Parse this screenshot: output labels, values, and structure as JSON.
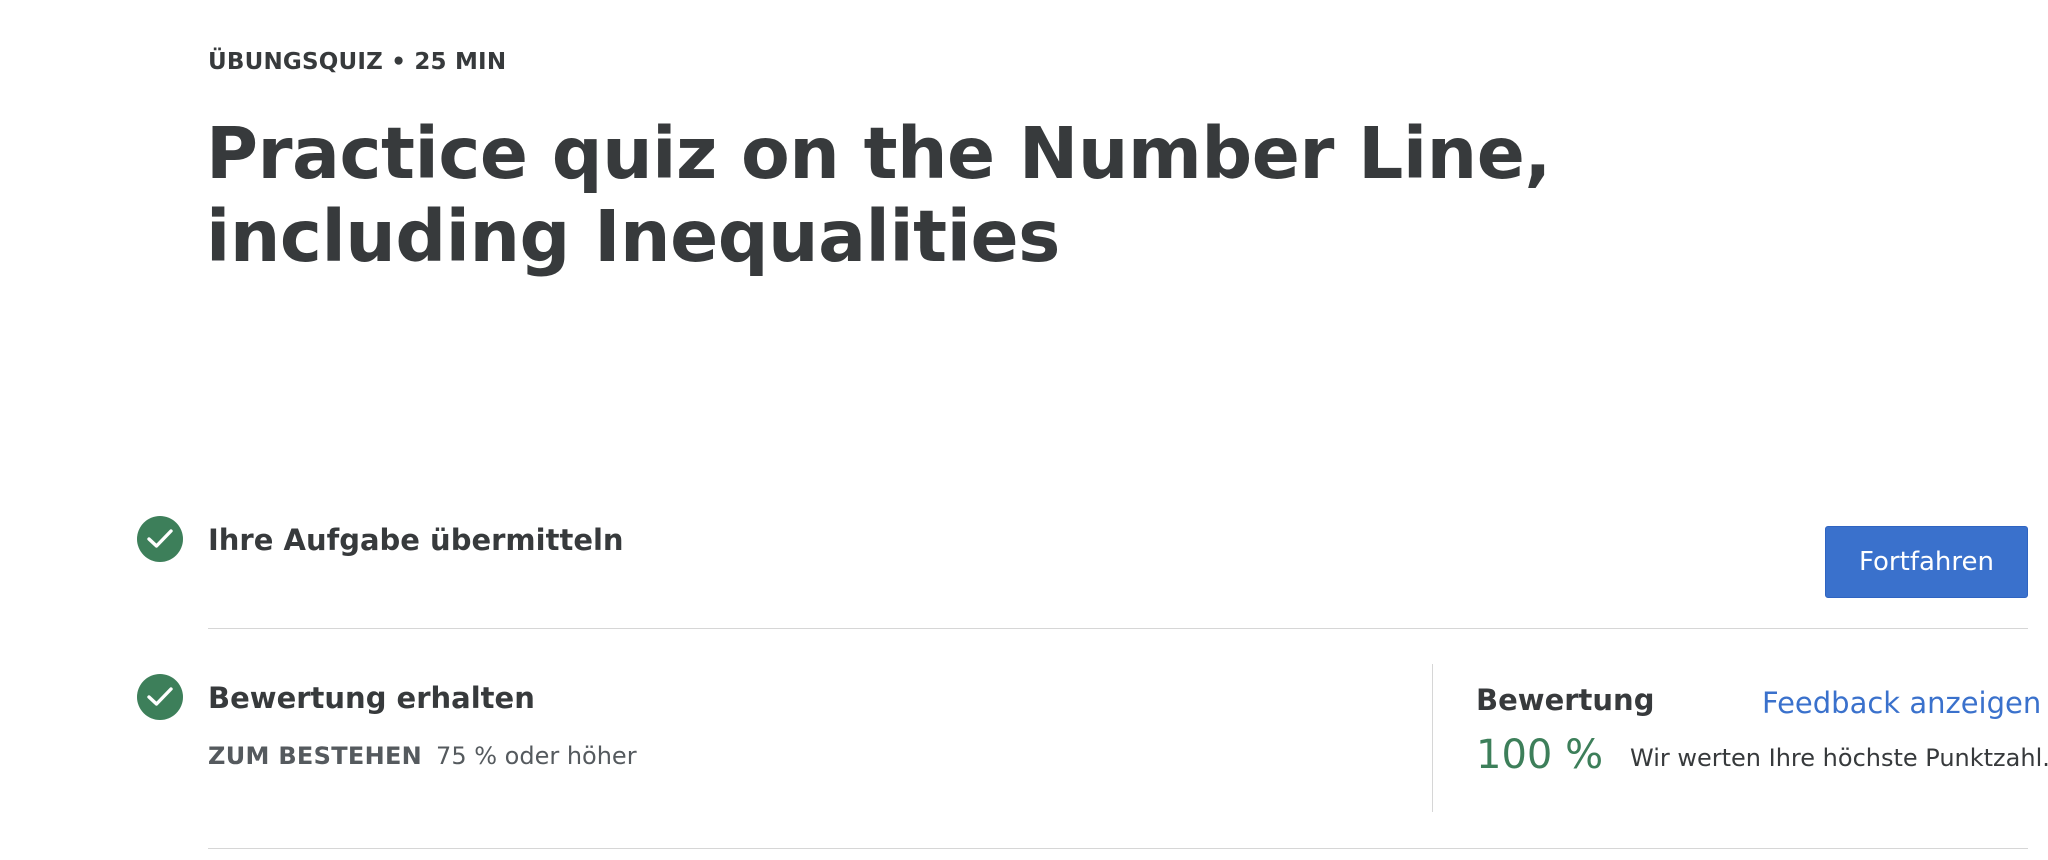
{
  "header": {
    "meta": "ÜBUNGSQUIZ • 25 MIN",
    "title": "Practice quiz on the Number Line, including Inequalities"
  },
  "submit_step": {
    "icon": "check-icon",
    "title": "Ihre Aufgabe übermitteln",
    "button_label": "Fortfahren"
  },
  "grade_step": {
    "icon": "check-icon",
    "title": "Bewertung erhalten",
    "pass_label": "ZUM BESTEHEN",
    "pass_value": "75 % oder höher",
    "grade_label": "Bewertung",
    "feedback_link": "Feedback anzeigen",
    "grade_value": "100 %",
    "grade_note": "Wir werten Ihre höchste Punktzahl."
  },
  "colors": {
    "success": "#3d7f5a",
    "accent": "#3a71cc",
    "text": "#373a3c"
  }
}
